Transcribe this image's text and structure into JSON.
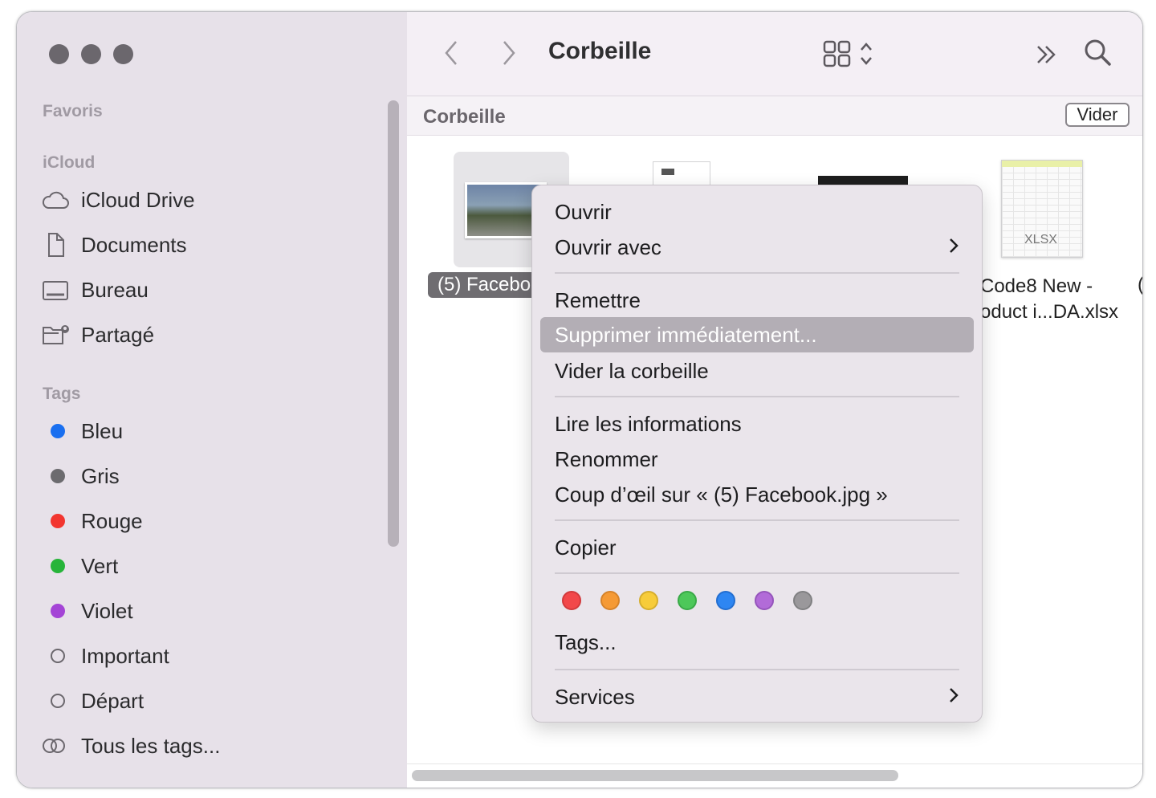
{
  "window": {
    "title": "Corbeille"
  },
  "sidebar": {
    "favoris_label": "Favoris",
    "icloud_label": "iCloud",
    "icloud_items": [
      {
        "label": "iCloud Drive",
        "icon": "cloud-icon"
      },
      {
        "label": "Documents",
        "icon": "document-icon"
      },
      {
        "label": "Bureau",
        "icon": "desktop-icon"
      },
      {
        "label": "Partagé",
        "icon": "shared-folder-icon"
      }
    ],
    "tags_label": "Tags",
    "tags": [
      {
        "label": "Bleu",
        "color": "#1a6ff0"
      },
      {
        "label": "Gris",
        "color": "#6c6b6f"
      },
      {
        "label": "Rouge",
        "color": "#f2352f"
      },
      {
        "label": "Vert",
        "color": "#27b43a"
      },
      {
        "label": "Violet",
        "color": "#a444d6"
      },
      {
        "label": "Important",
        "color": ""
      },
      {
        "label": "Départ",
        "color": ""
      }
    ],
    "all_tags_label": "Tous les tags..."
  },
  "toolbar": {
    "title": "Corbeille"
  },
  "pathbar": {
    "title": "Corbeille",
    "empty_button": "Vider"
  },
  "files": [
    {
      "name": "(5) Facebo",
      "selected": true
    },
    {
      "name_line1": "Code8 New -",
      "name_line2": "oduct i...DA.xlsx",
      "type_badge": "XLSX"
    },
    {
      "partial": "("
    }
  ],
  "context_menu": {
    "open": "Ouvrir",
    "open_with": "Ouvrir avec",
    "put_back": "Remettre",
    "delete_now": "Supprimer immédiatement...",
    "empty_trash": "Vider la corbeille",
    "get_info": "Lire les informations",
    "rename": "Renommer",
    "quick_look": "Coup d’œil sur « (5) Facebook.jpg »",
    "copy": "Copier",
    "tag_colors": [
      "#f2484a",
      "#f59a35",
      "#f7cc3a",
      "#4dc85a",
      "#2e86f2",
      "#b26bd8",
      "#9a989b"
    ],
    "tags": "Tags...",
    "services": "Services"
  }
}
